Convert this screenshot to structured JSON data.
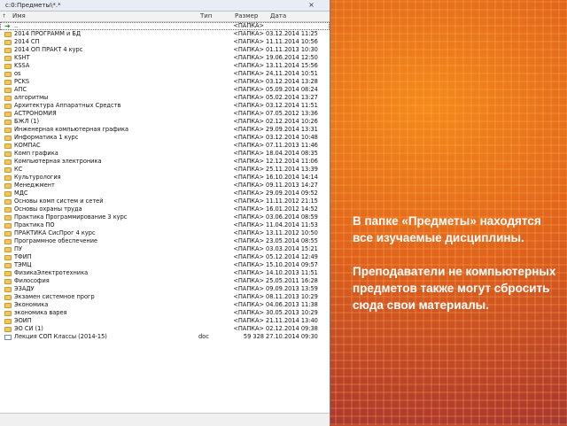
{
  "window": {
    "path": "c:0:Предметы\\*.*"
  },
  "header": {
    "name": "Имя",
    "ext": "Тип",
    "size": "Размер",
    "date": "Дата"
  },
  "rows": [
    {
      "name": "..",
      "ext": "",
      "size": "<ПАПКА>",
      "date": "",
      "type": "up"
    },
    {
      "name": "2014 ПРОГРАММ и БД",
      "ext": "",
      "size": "<ПАПКА>",
      "date": "03.12.2014 11:25",
      "type": "folder"
    },
    {
      "name": "2014 СП",
      "ext": "",
      "size": "<ПАПКА>",
      "date": "11.11.2014 10:56",
      "type": "folder"
    },
    {
      "name": "2014 ОП ПРАКТ 4 курс",
      "ext": "",
      "size": "<ПАПКА>",
      "date": "01.11.2013 10:30",
      "type": "folder"
    },
    {
      "name": "KSHT",
      "ext": "",
      "size": "<ПАПКА>",
      "date": "19.06.2014 12:50",
      "type": "folder"
    },
    {
      "name": "KSSA",
      "ext": "",
      "size": "<ПАПКА>",
      "date": "13.11.2014 15:56",
      "type": "folder"
    },
    {
      "name": "os",
      "ext": "",
      "size": "<ПАПКА>",
      "date": "24.11.2014 10:51",
      "type": "folder"
    },
    {
      "name": "PCKS",
      "ext": "",
      "size": "<ПАПКА>",
      "date": "03.12.2014 13:28",
      "type": "folder"
    },
    {
      "name": "АПС",
      "ext": "",
      "size": "<ПАПКА>",
      "date": "05.09.2014 08:24",
      "type": "folder"
    },
    {
      "name": "алгоритмы",
      "ext": "",
      "size": "<ПАПКА>",
      "date": "05.02.2014 13:27",
      "type": "folder"
    },
    {
      "name": "Архитектура Аппаратных Средств",
      "ext": "",
      "size": "<ПАПКА>",
      "date": "03.12.2014 11:51",
      "type": "folder"
    },
    {
      "name": "АСТРОНОМИЯ",
      "ext": "",
      "size": "<ПАПКА>",
      "date": "07.05.2012 13:36",
      "type": "folder"
    },
    {
      "name": "БЖЛ (1)",
      "ext": "",
      "size": "<ПАПКА>",
      "date": "02.12.2014 10:26",
      "type": "folder"
    },
    {
      "name": "Инженерная компьютерная графика",
      "ext": "",
      "size": "<ПАПКА>",
      "date": "29.09.2014 13:31",
      "type": "folder"
    },
    {
      "name": "Информатика 1 курс",
      "ext": "",
      "size": "<ПАПКА>",
      "date": "03.12.2014 10:48",
      "type": "folder"
    },
    {
      "name": "КОМПАС",
      "ext": "",
      "size": "<ПАПКА>",
      "date": "07.11.2013 11:46",
      "type": "folder"
    },
    {
      "name": "Комп графика",
      "ext": "",
      "size": "<ПАПКА>",
      "date": "18.04.2014 08:35",
      "type": "folder"
    },
    {
      "name": "Компьютерная электроника",
      "ext": "",
      "size": "<ПАПКА>",
      "date": "12.12.2014 11:06",
      "type": "folder"
    },
    {
      "name": "КС",
      "ext": "",
      "size": "<ПАПКА>",
      "date": "25.11.2014 13:39",
      "type": "folder"
    },
    {
      "name": "Культурология",
      "ext": "",
      "size": "<ПАПКА>",
      "date": "16.10.2014 14:14",
      "type": "folder"
    },
    {
      "name": "Менеджмент",
      "ext": "",
      "size": "<ПАПКА>",
      "date": "09.11.2013 14:27",
      "type": "folder"
    },
    {
      "name": "МДС",
      "ext": "",
      "size": "<ПАПКА>",
      "date": "29.09.2014 09:52",
      "type": "folder"
    },
    {
      "name": "Основы комп систем и сетей",
      "ext": "",
      "size": "<ПАПКА>",
      "date": "11.11.2012 21:15",
      "type": "folder"
    },
    {
      "name": "Основы охраны труда",
      "ext": "",
      "size": "<ПАПКА>",
      "date": "16.01.2012 14:52",
      "type": "folder"
    },
    {
      "name": "Практика Программирование 3 курс",
      "ext": "",
      "size": "<ПАПКА>",
      "date": "03.06.2014 08:59",
      "type": "folder"
    },
    {
      "name": "Практика ПО",
      "ext": "",
      "size": "<ПАПКА>",
      "date": "11.04.2014 11:53",
      "type": "folder"
    },
    {
      "name": "ПРАКТИКА СисПрог 4 курс",
      "ext": "",
      "size": "<ПАПКА>",
      "date": "13.11.2012 10:50",
      "type": "folder"
    },
    {
      "name": "Программное обеспечение",
      "ext": "",
      "size": "<ПАПКА>",
      "date": "23.05.2014 08:55",
      "type": "folder"
    },
    {
      "name": "ПУ",
      "ext": "",
      "size": "<ПАПКА>",
      "date": "03.03.2014 15:21",
      "type": "folder"
    },
    {
      "name": "ТФИП",
      "ext": "",
      "size": "<ПАПКА>",
      "date": "05.12.2014 12:49",
      "type": "folder"
    },
    {
      "name": "ТЭМЦ",
      "ext": "",
      "size": "<ПАПКА>",
      "date": "15.10.2014 09:57",
      "type": "folder"
    },
    {
      "name": "ФизикаЭлектротехника",
      "ext": "",
      "size": "<ПАПКА>",
      "date": "14.10.2013 11:51",
      "type": "folder"
    },
    {
      "name": "Философия",
      "ext": "",
      "size": "<ПАПКА>",
      "date": "25.05.2011 16:28",
      "type": "folder"
    },
    {
      "name": "ЭЗАДУ",
      "ext": "",
      "size": "<ПАПКА>",
      "date": "09.09.2013 13:59",
      "type": "folder"
    },
    {
      "name": "Экзамен системное прогр",
      "ext": "",
      "size": "<ПАПКА>",
      "date": "08.11.2013 10:29",
      "type": "folder"
    },
    {
      "name": "Экономика",
      "ext": "",
      "size": "<ПАПКА>",
      "date": "04.06.2013 11:38",
      "type": "folder"
    },
    {
      "name": "экономика варея",
      "ext": "",
      "size": "<ПАПКА>",
      "date": "30.05.2013 10:29",
      "type": "folder"
    },
    {
      "name": "ЭОИП",
      "ext": "",
      "size": "<ПАПКА>",
      "date": "21.11.2014 13:40",
      "type": "folder"
    },
    {
      "name": "ЭО СИ (1)",
      "ext": "",
      "size": "<ПАПКА>",
      "date": "02.12.2014 09:38",
      "type": "folder"
    },
    {
      "name": "Лекция СОП Классы (2014-15)",
      "ext": "doc",
      "size": "59 328",
      "date": "27.10.2014 09:30",
      "type": "file"
    }
  ],
  "caption": {
    "p1": "В папке «Предметы» находятся все изучаемые дисциплины.",
    "p2": "Преподаватели не компьютерных предметов также могут сбросить сюда свои материалы."
  }
}
